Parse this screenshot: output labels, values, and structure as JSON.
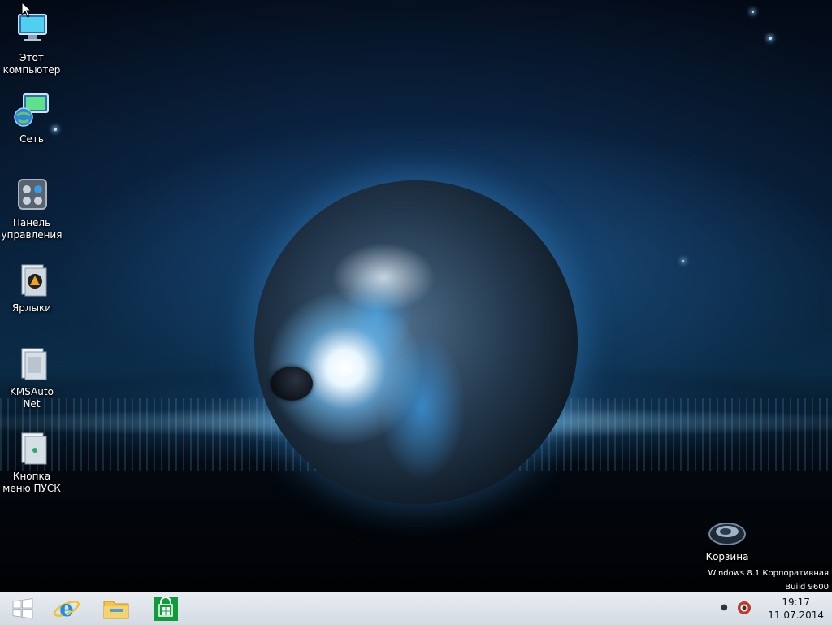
{
  "desktop": {
    "icons": [
      {
        "label": "Этот\nкомпьютер",
        "icon": "this-pc-icon"
      },
      {
        "label": "Сеть",
        "icon": "network-icon"
      },
      {
        "label": "Панель\nуправления",
        "icon": "control-panel-icon"
      },
      {
        "label": "Ярлыки",
        "icon": "shortcuts-folder-icon"
      },
      {
        "label": "KMSAuto Net",
        "icon": "folder-icon"
      },
      {
        "label": "Кнопка\nменю ПУСК",
        "icon": "folder-icon"
      },
      {
        "label": "Корзина",
        "icon": "recycle-bin-icon"
      }
    ],
    "watermark": {
      "edition": "Windows 8.1 Корпоративная",
      "build": "Build 9600"
    }
  },
  "taskbar": {
    "pinned": [
      {
        "name": "start-button",
        "icon": "windows-logo-icon"
      },
      {
        "name": "internet-explorer",
        "icon": "internet-explorer-icon"
      },
      {
        "name": "file-explorer",
        "icon": "file-explorer-icon"
      },
      {
        "name": "store",
        "icon": "store-icon"
      }
    ],
    "tray": {
      "time": "19:17",
      "date": "11.07.2014"
    }
  },
  "colors": {
    "taskbar_bg": "#dfe4ea",
    "store_green": "#0f9d3b",
    "ie_blue": "#1e90e0",
    "folder_yellow": "#f3c34a"
  }
}
